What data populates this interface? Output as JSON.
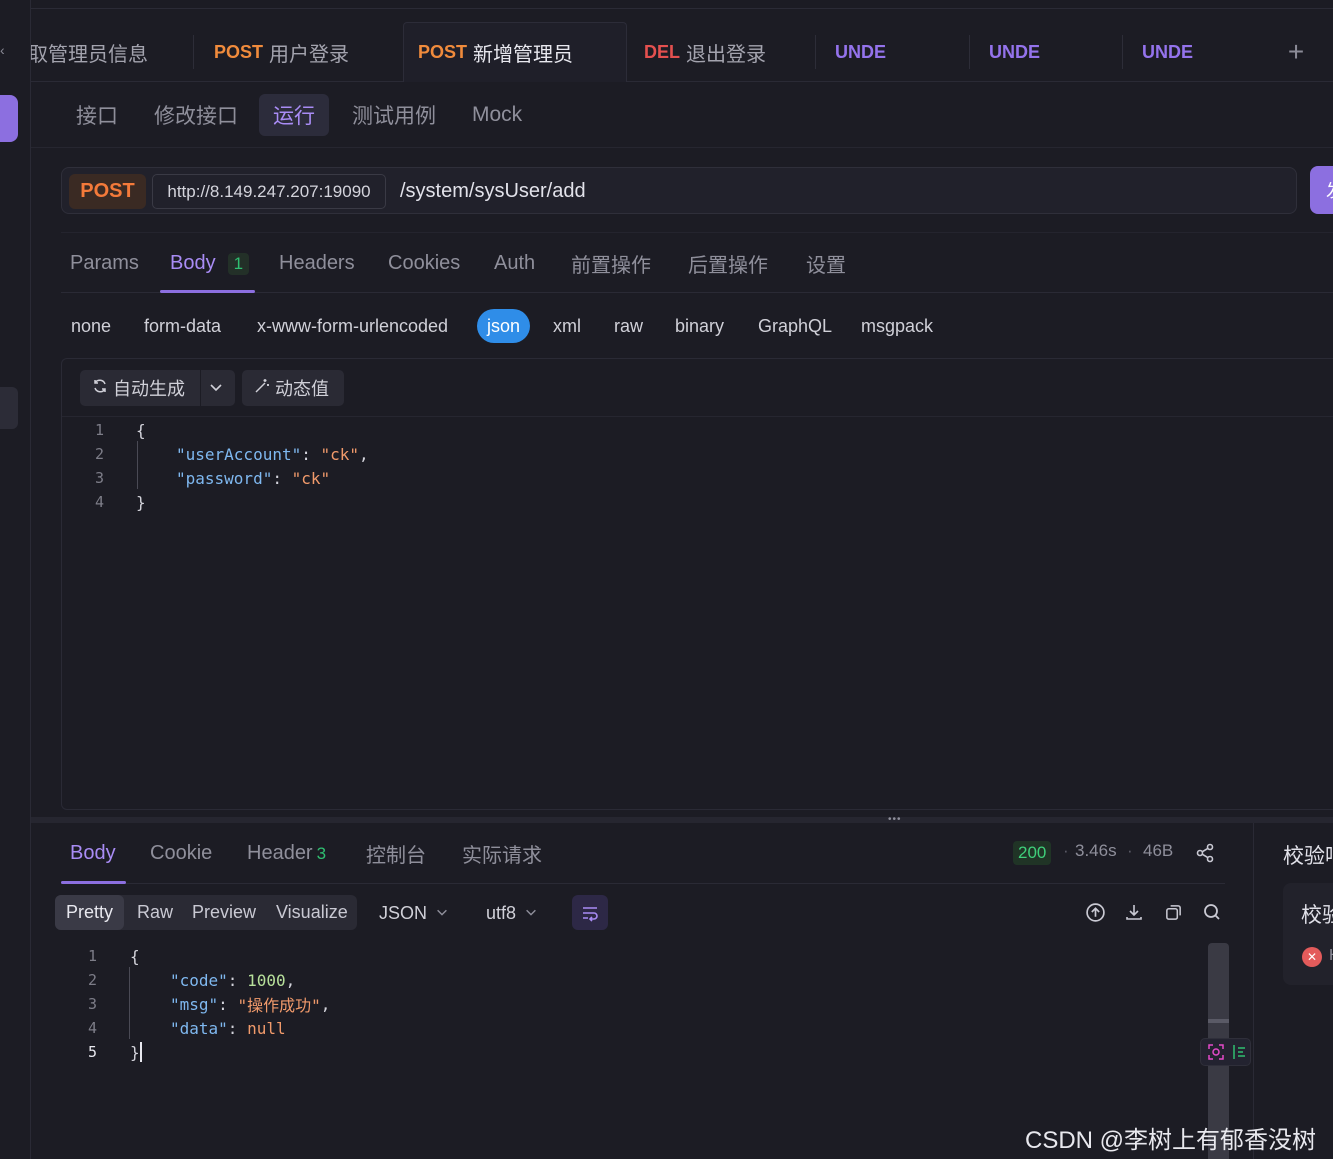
{
  "tabs": [
    {
      "method": "",
      "title": "取管理员信息",
      "active": false
    },
    {
      "method": "POST",
      "title": "用户登录",
      "active": false
    },
    {
      "method": "POST",
      "title": "新增管理员",
      "active": true
    },
    {
      "method": "DEL",
      "title": "退出登录",
      "active": false
    },
    {
      "method": "UNDE",
      "title": "",
      "active": false
    },
    {
      "method": "UNDE",
      "title": "",
      "active": false
    },
    {
      "method": "UNDE",
      "title": "",
      "active": false
    }
  ],
  "tab_add_label": "+",
  "subtabs": [
    "接口",
    "修改接口",
    "运行",
    "测试用例",
    "Mock"
  ],
  "subtab_active": "运行",
  "request": {
    "method": "POST",
    "base_url": "http://8.149.247.207:19090",
    "path": "/system/sysUser/add",
    "send_label": "发"
  },
  "request_tabs": [
    {
      "label": "Params"
    },
    {
      "label": "Body",
      "badge": "1",
      "active": true
    },
    {
      "label": "Headers"
    },
    {
      "label": "Cookies"
    },
    {
      "label": "Auth"
    },
    {
      "label": "前置操作"
    },
    {
      "label": "后置操作"
    },
    {
      "label": "设置"
    }
  ],
  "body_types": [
    "none",
    "form-data",
    "x-www-form-urlencoded",
    "json",
    "xml",
    "raw",
    "binary",
    "GraphQL",
    "msgpack"
  ],
  "body_type_active": "json",
  "editor_toolbar": {
    "auto_generate": "自动生成",
    "dynamic_value": "动态值"
  },
  "request_body_lines": [
    {
      "no": "1",
      "text": "{"
    },
    {
      "no": "2",
      "key": "\"userAccount\"",
      "value": "\"ck\"",
      "trail": ","
    },
    {
      "no": "3",
      "key": "\"password\"",
      "value": "\"ck\"",
      "trail": ""
    },
    {
      "no": "4",
      "text": "}"
    }
  ],
  "response": {
    "tabs": [
      {
        "label": "Body",
        "active": true
      },
      {
        "label": "Cookie"
      },
      {
        "label": "Header",
        "badge": "3"
      },
      {
        "label": "控制台"
      },
      {
        "label": "实际请求"
      }
    ],
    "status": "200",
    "time": "3.46s",
    "size": "46B",
    "views": [
      "Pretty",
      "Raw",
      "Preview",
      "Visualize"
    ],
    "view_active": "Pretty",
    "format": "JSON",
    "encoding": "utf8",
    "lines": [
      {
        "no": "1",
        "text": "{"
      },
      {
        "no": "2",
        "key": "\"code\"",
        "value": "1000",
        "vtype": "num",
        "trail": ","
      },
      {
        "no": "3",
        "key": "\"msg\"",
        "value": "\"操作成功\"",
        "vtype": "str",
        "trail": ","
      },
      {
        "no": "4",
        "key": "\"data\"",
        "value": "null",
        "vtype": "null",
        "trail": ""
      },
      {
        "no": "5",
        "text": "}"
      }
    ]
  },
  "right_panel": {
    "title": "校验响",
    "card_title": "校验",
    "card_item": "H"
  },
  "watermark": "CSDN @李树上有郁香没树",
  "colors": {
    "accent": "#8c6fe0",
    "post": "#f08b3c",
    "del": "#e4504f",
    "unde": "#9473ec",
    "json_chip": "#2f8de8",
    "status_ok": "#3fcf7a"
  },
  "icons": [
    "chevron-left-icon",
    "refresh-icon",
    "chevron-down-icon",
    "magic-wand-icon",
    "share-icon",
    "wrap-lines-icon",
    "upload-icon",
    "download-icon",
    "copy-icon",
    "search-icon",
    "error-icon"
  ]
}
